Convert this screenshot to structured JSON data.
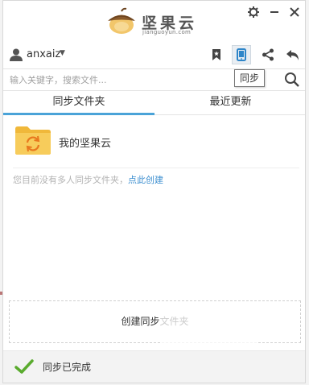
{
  "app": {
    "logo_text": "坚果云",
    "logo_subtext": "jianguoyun.com"
  },
  "window_controls": {
    "settings_icon": "gear-icon",
    "minimize_icon": "minimize-icon",
    "close_icon": "close-icon"
  },
  "user": {
    "name": "anxaiz"
  },
  "toolbar": {
    "items": [
      {
        "icon": "bookmark-icon"
      },
      {
        "icon": "tablet-sync-icon",
        "active": true
      },
      {
        "icon": "share-icon"
      },
      {
        "icon": "undo-icon"
      }
    ],
    "tooltip": "同步"
  },
  "search": {
    "placeholder": "输入关键字，搜索文件...",
    "value": ""
  },
  "tabs": [
    {
      "label": "同步文件夹",
      "active": true
    },
    {
      "label": "最近更新",
      "active": false
    }
  ],
  "folders": [
    {
      "label": "我的坚果云",
      "icon": "sync-folder-icon"
    }
  ],
  "hint": {
    "text": "您目前没有多人同步文件夹，",
    "link": "点此创建"
  },
  "create_button": {
    "label": "创建同步文件夹"
  },
  "status": {
    "text": "同步已完成",
    "icon": "checkmark-icon"
  },
  "colors": {
    "accent": "#4aa3d8",
    "link": "#3d8fd0",
    "success": "#5aab2e",
    "folder": "#f5c24f"
  }
}
